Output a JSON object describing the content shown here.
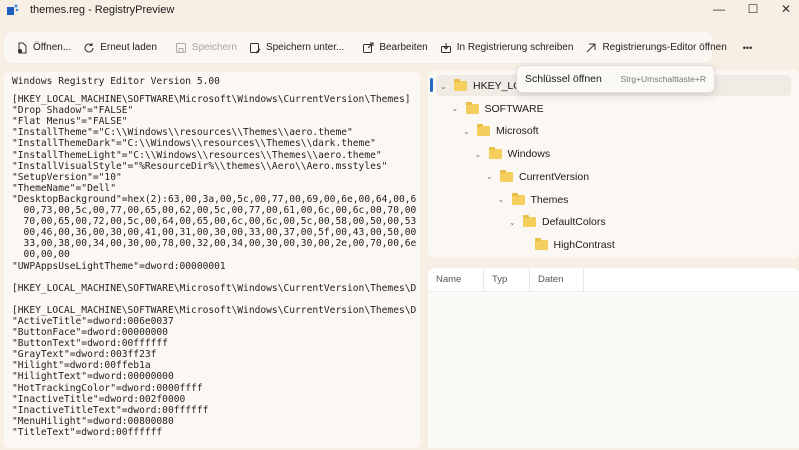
{
  "window": {
    "title": "themes.reg - RegistryPreview",
    "minimize": "—",
    "maximize": "☐",
    "close": "✕"
  },
  "toolbar": {
    "open": "Öffnen...",
    "reload": "Erneut laden",
    "save": "Speichern",
    "save_as": "Speichern unter...",
    "edit": "Bearbeiten",
    "write": "In Registrierung schreiben",
    "open_regedit": "Registrierungs-Editor öffnen",
    "more": "•••"
  },
  "flyout": {
    "label": "Schlüssel öffnen",
    "shortcut": "Strg+Umschalttaste+R"
  },
  "editor": {
    "lines": [
      "Windows Registry Editor Version 5.00",
      "",
      "[HKEY_LOCAL_MACHINE\\SOFTWARE\\Microsoft\\Windows\\CurrentVersion\\Themes]",
      "\"Drop Shadow\"=\"FALSE\"",
      "\"Flat Menus\"=\"FALSE\"",
      "\"InstallTheme\"=\"C:\\\\Windows\\\\resources\\\\Themes\\\\aero.theme\"",
      "\"InstallThemeDark\"=\"C:\\\\Windows\\\\resources\\\\Themes\\\\dark.theme\"",
      "\"InstallThemeLight\"=\"C:\\\\Windows\\\\resources\\\\Themes\\\\aero.theme\"",
      "\"InstallVisualStyle\"=\"%ResourceDir%\\\\themes\\\\Aero\\\\Aero.msstyles\"",
      "\"SetupVersion\"=\"10\"",
      "\"ThemeName\"=\"Dell\"",
      "\"DesktopBackground\"=hex(2):63,00,3a,00,5c,00,77,00,69,00,6e,00,64,00,6",
      "  00,73,00,5c,00,77,00,65,00,62,00,5c,00,77,00,61,00,6c,00,6c,00,70,00",
      "  70,00,65,00,72,00,5c,00,64,00,65,00,6c,00,6c,00,5c,00,58,00,50,00,53",
      "  00,46,00,36,00,30,00,41,00,31,00,30,00,33,00,37,00,5f,00,43,00,50,00",
      "  33,00,38,00,34,00,30,00,78,00,32,00,34,00,30,00,30,00,2e,00,70,00,6e",
      "  00,00,00",
      "\"UWPAppsUseLightTheme\"=dword:00000001",
      "",
      "[HKEY_LOCAL_MACHINE\\SOFTWARE\\Microsoft\\Windows\\CurrentVersion\\Themes\\D",
      "",
      "[HKEY_LOCAL_MACHINE\\SOFTWARE\\Microsoft\\Windows\\CurrentVersion\\Themes\\D",
      "\"ActiveTitle\"=dword:006e0037",
      "\"ButtonFace\"=dword:00000000",
      "\"ButtonText\"=dword:00ffffff",
      "\"GrayText\"=dword:003ff23f",
      "\"Hilight\"=dword:00ffeb1a",
      "\"HilightText\"=dword:00000000",
      "\"HotTrackingColor\"=dword:0000ffff",
      "\"InactiveTitle\"=dword:002f0000",
      "\"InactiveTitleText\"=dword:00ffffff",
      "\"MenuHilight\"=dword:00800080",
      "\"TitleText\"=dword:00ffffff"
    ]
  },
  "tree": {
    "nodes": [
      {
        "label": "HKEY_LOCAL_MACHINE",
        "expanded": true
      },
      {
        "label": "SOFTWARE",
        "expanded": true
      },
      {
        "label": "Microsoft",
        "expanded": true
      },
      {
        "label": "Windows",
        "expanded": true
      },
      {
        "label": "CurrentVersion",
        "expanded": true
      },
      {
        "label": "Themes",
        "expanded": true
      },
      {
        "label": "DefaultColors",
        "expanded": true
      },
      {
        "label": "HighContrast",
        "expanded": false
      }
    ]
  },
  "table": {
    "columns": [
      "Name",
      "Typ",
      "Daten"
    ]
  }
}
